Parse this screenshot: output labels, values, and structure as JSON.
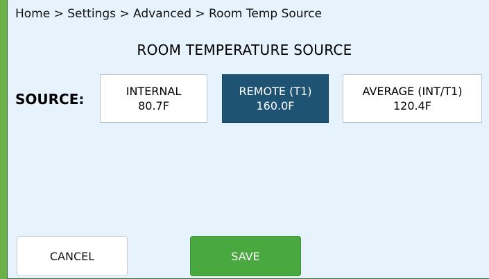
{
  "breadcrumb": "Home > Settings > Advanced > Room Temp Source",
  "title": "ROOM TEMPERATURE SOURCE",
  "source_label": "SOURCE:",
  "options": [
    {
      "label": "INTERNAL",
      "value": "80.7F",
      "selected": false
    },
    {
      "label": "REMOTE (T1)",
      "value": "160.0F",
      "selected": true
    },
    {
      "label": "AVERAGE (INT/T1)",
      "value": "120.4F",
      "selected": false
    }
  ],
  "buttons": {
    "cancel": "CANCEL",
    "save": "SAVE"
  },
  "colors": {
    "panel_background": "#e6f2fc",
    "selected_option": "#1e5373",
    "save_button": "#49a83f",
    "left_bar": "#6bb24a"
  }
}
